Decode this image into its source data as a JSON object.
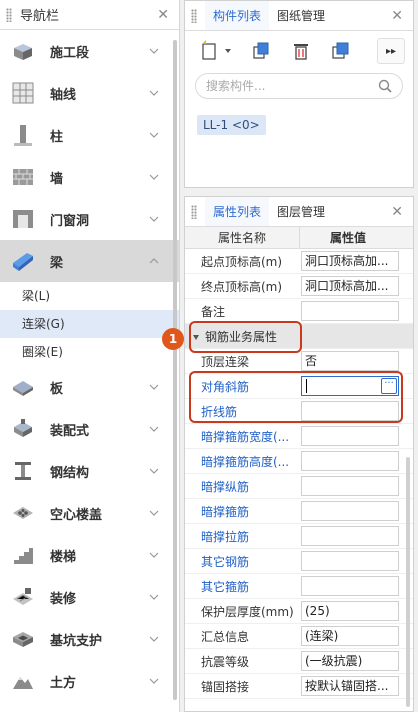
{
  "nav": {
    "title": "导航栏",
    "items_before": [
      {
        "label": "施工段",
        "icon": "construction-section-icon"
      },
      {
        "label": "轴线",
        "icon": "axis-grid-icon"
      },
      {
        "label": "柱",
        "icon": "column-icon"
      },
      {
        "label": "墙",
        "icon": "wall-icon"
      },
      {
        "label": "门窗洞",
        "icon": "door-window-icon"
      }
    ],
    "active_item": {
      "label": "梁",
      "icon": "beam-icon"
    },
    "sub_items": [
      {
        "label": "梁(L)"
      },
      {
        "label": "连梁(G)",
        "selected": true
      },
      {
        "label": "圈梁(E)"
      }
    ],
    "items_after": [
      {
        "label": "板",
        "icon": "slab-icon"
      },
      {
        "label": "装配式",
        "icon": "prefab-icon"
      },
      {
        "label": "钢结构",
        "icon": "steel-structure-icon"
      },
      {
        "label": "空心楼盖",
        "icon": "hollow-floor-icon"
      },
      {
        "label": "楼梯",
        "icon": "stairs-icon"
      },
      {
        "label": "装修",
        "icon": "decoration-icon"
      },
      {
        "label": "基坑支护",
        "icon": "pit-support-icon"
      },
      {
        "label": "土方",
        "icon": "earthwork-icon"
      }
    ]
  },
  "component_panel": {
    "tabs": [
      "构件列表",
      "图纸管理"
    ],
    "search_placeholder": "搜索构件...",
    "selected_component": "LL-1 <0>"
  },
  "property_panel": {
    "tabs": [
      "属性列表",
      "图层管理"
    ],
    "columns": [
      "属性名称",
      "属性值"
    ],
    "rows_top": [
      {
        "name": "起点顶标高(m)",
        "value": "洞口顶标高加..."
      },
      {
        "name": "终点顶标高(m)",
        "value": "洞口顶标高加..."
      },
      {
        "name": "备注",
        "value": ""
      }
    ],
    "group": {
      "name": "钢筋业务属性"
    },
    "rows_group": [
      {
        "name": "顶层连梁",
        "value": "否",
        "blue": false
      },
      {
        "name": "对角斜筋",
        "value": "",
        "blue": true,
        "editing": true
      },
      {
        "name": "折线筋",
        "value": "",
        "blue": true
      },
      {
        "name": "暗撑箍筋宽度(...",
        "value": "",
        "blue": true
      },
      {
        "name": "暗撑箍筋高度(...",
        "value": "",
        "blue": true
      },
      {
        "name": "暗撑纵筋",
        "value": "",
        "blue": true
      },
      {
        "name": "暗撑箍筋",
        "value": "",
        "blue": true
      },
      {
        "name": "暗撑拉筋",
        "value": "",
        "blue": true
      },
      {
        "name": "其它钢筋",
        "value": "",
        "blue": true
      },
      {
        "name": "其它箍筋",
        "value": "",
        "blue": true
      },
      {
        "name": "保护层厚度(mm)",
        "value": "(25)",
        "blue": false
      },
      {
        "name": "汇总信息",
        "value": "(连梁)",
        "blue": false
      },
      {
        "name": "抗震等级",
        "value": "(一级抗震)",
        "blue": false
      },
      {
        "name": "锚固搭接",
        "value": "按默认锚固搭...",
        "blue": false
      }
    ],
    "ellipsis": "···"
  },
  "annotation": {
    "marker": "1",
    "color": "#c8391d"
  }
}
